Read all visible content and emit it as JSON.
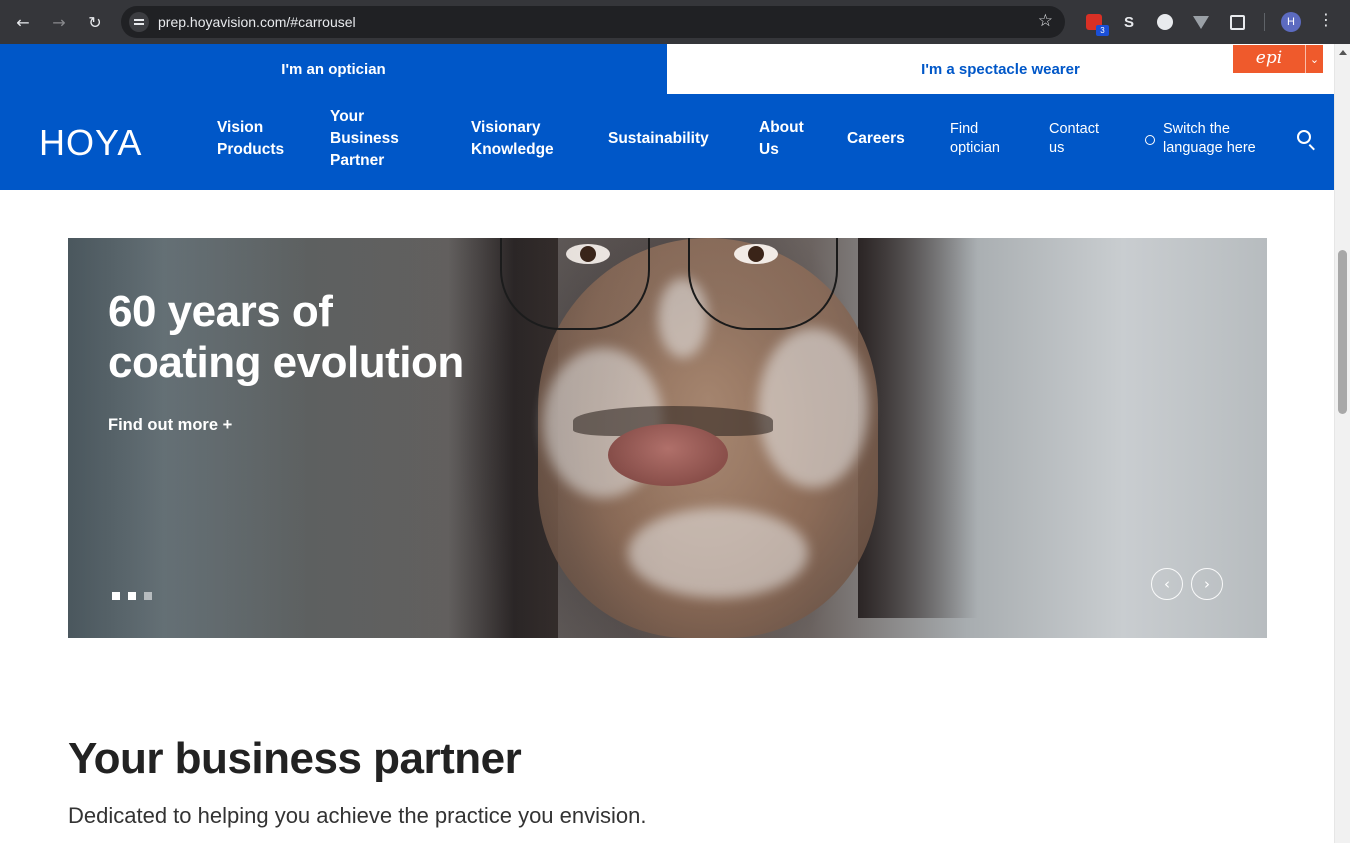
{
  "browser": {
    "url": "prep.hoyavision.com/#carrousel",
    "extension_badge": "3",
    "extension_s_label": "S",
    "profile_initial": "H"
  },
  "audience": {
    "optician_label": "I'm an optician",
    "wearer_label": "I'm a spectacle wearer",
    "epi_logo": "epi"
  },
  "nav": {
    "logo": "HOYA",
    "vision_products": [
      "Vision",
      "Products"
    ],
    "business_partner": [
      "Your",
      "Business",
      "Partner"
    ],
    "visionary_knowledge": [
      "Visionary",
      "Knowledge"
    ],
    "sustainability": "Sustainability",
    "about_us": [
      "About",
      "Us"
    ],
    "careers": "Careers",
    "find_optician": [
      "Find",
      "optician"
    ],
    "contact_us": [
      "Contact",
      "us"
    ],
    "language": [
      "Switch the",
      "language here"
    ]
  },
  "hero": {
    "title_line1": "60 years of",
    "title_line2": "coating evolution",
    "cta": "Find out more  +",
    "slides_count": 3,
    "active_slide": 1
  },
  "section": {
    "title": "Your business partner",
    "subtitle": "Dedicated to helping you achieve the practice you envision."
  },
  "colors": {
    "brand_blue": "#0057c8",
    "epi_orange": "#ef5a2c"
  }
}
